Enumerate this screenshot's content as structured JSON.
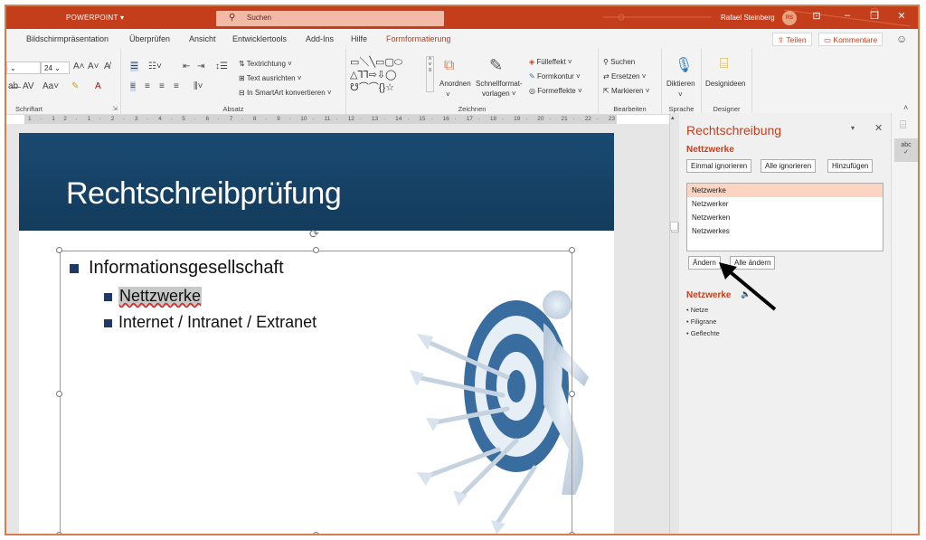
{
  "titlebar": {
    "app_name": "POWERPOINT ▾",
    "search_placeholder": "Suchen",
    "user_name": "Rafael Steinberg",
    "user_initials": "RS"
  },
  "tabs": [
    {
      "label": "Bildschirmpräsentation"
    },
    {
      "label": "Überprüfen"
    },
    {
      "label": "Ansicht"
    },
    {
      "label": "Entwicklertools"
    },
    {
      "label": "Add-Ins"
    },
    {
      "label": "Hilfe"
    },
    {
      "label": "Formformatierung"
    }
  ],
  "share": {
    "share_label": "Teilen",
    "comments_label": "Kommentare"
  },
  "ribbon": {
    "font": {
      "size": "24",
      "group_label": "Schriftart"
    },
    "paragraph": {
      "text_direction": "Textrichtung ˅",
      "align_text": "Text ausrichten ˅",
      "smartart": "In SmartArt konvertieren ˅",
      "group_label": "Absatz"
    },
    "drawing": {
      "arrange": "Anordnen",
      "quickstyles_1": "Schnellformat-",
      "quickstyles_2": "vorlagen ˅",
      "fill": "Fülleffekt ˅",
      "outline": "Formkontur ˅",
      "effects": "Formeffekte ˅",
      "group_label": "Zeichnen"
    },
    "editing": {
      "find": "Suchen",
      "replace": "Ersetzen ˅",
      "select": "Markieren ˅",
      "group_label": "Bearbeiten"
    },
    "voice": {
      "dictate": "Diktieren",
      "group_label": "Sprache"
    },
    "designer": {
      "ideas": "Designideen",
      "group_label": "Designer"
    }
  },
  "ruler": {
    "ticks": [
      "1",
      "·",
      "1",
      "2",
      "·",
      "1",
      "·",
      "2",
      "·",
      "3",
      "·",
      "4",
      "·",
      "5",
      "·",
      "6",
      "·",
      "7",
      "·",
      "8",
      "·",
      "9",
      "·",
      "10",
      "·",
      "11",
      "·",
      "12",
      "·",
      "13",
      "·",
      "14",
      "·",
      "15",
      "·",
      "16",
      "·",
      "17",
      "·",
      "18",
      "·",
      "19",
      "·",
      "20",
      "·",
      "21",
      "·",
      "22",
      "·",
      "23"
    ]
  },
  "slide": {
    "title": "Rechtschreibprüfung",
    "bullet_1": "Informationsgesellschaft",
    "bullet_2": "Nettzwerke",
    "bullet_3": "Internet / Intranet / Extranet"
  },
  "spelling_pane": {
    "title": "Rechtschreibung",
    "misspelled_word": "Nettzwerke",
    "ignore_once": "Einmal ignorieren",
    "ignore_all": "Alle ignorieren",
    "add": "Hinzufügen",
    "suggestions": [
      "Netzwerke",
      "Netzwerker",
      "Netzwerken",
      "Netzwerkes"
    ],
    "change": "Ändern",
    "change_all": "Alle ändern",
    "definition_word": "Netzwerke",
    "synonyms": [
      "Netze",
      "Filigrane",
      "Geflechte"
    ]
  },
  "colors": {
    "accent": "#c43e1c",
    "slide_header": "#133b5c",
    "bullet": "#1f3864",
    "selected_suggestion": "#fbd5c1"
  }
}
